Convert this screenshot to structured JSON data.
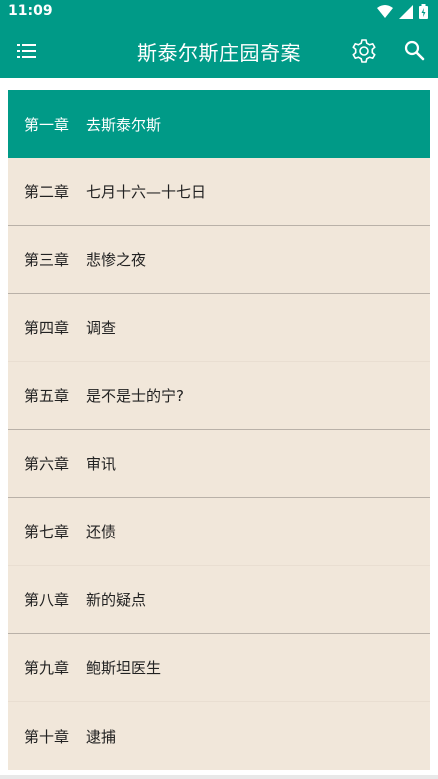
{
  "status_bar": {
    "time": "11:09",
    "icons": [
      "wifi-icon",
      "signal-icon",
      "battery-icon"
    ]
  },
  "app_bar": {
    "title": "斯泰尔斯庄园奇案",
    "icons": [
      "menu-icon",
      "gear-icon",
      "search-icon"
    ]
  },
  "colors": {
    "accent": "#009a87",
    "list_background": "#f1e7da",
    "text": "#222222"
  },
  "chapters": [
    {
      "number": "第一章",
      "title": "去斯泰尔斯",
      "selected": true
    },
    {
      "number": "第二章",
      "title": "七月十六—十七日"
    },
    {
      "number": "第三章",
      "title": "悲惨之夜"
    },
    {
      "number": "第四章",
      "title": "调查"
    },
    {
      "number": "第五章",
      "title": "是不是士的宁?"
    },
    {
      "number": "第六章",
      "title": "审讯"
    },
    {
      "number": "第七章",
      "title": "还债"
    },
    {
      "number": "第八章",
      "title": "新的疑点"
    },
    {
      "number": "第九章",
      "title": "鲍斯坦医生"
    },
    {
      "number": "第十章",
      "title": "逮捕"
    }
  ]
}
